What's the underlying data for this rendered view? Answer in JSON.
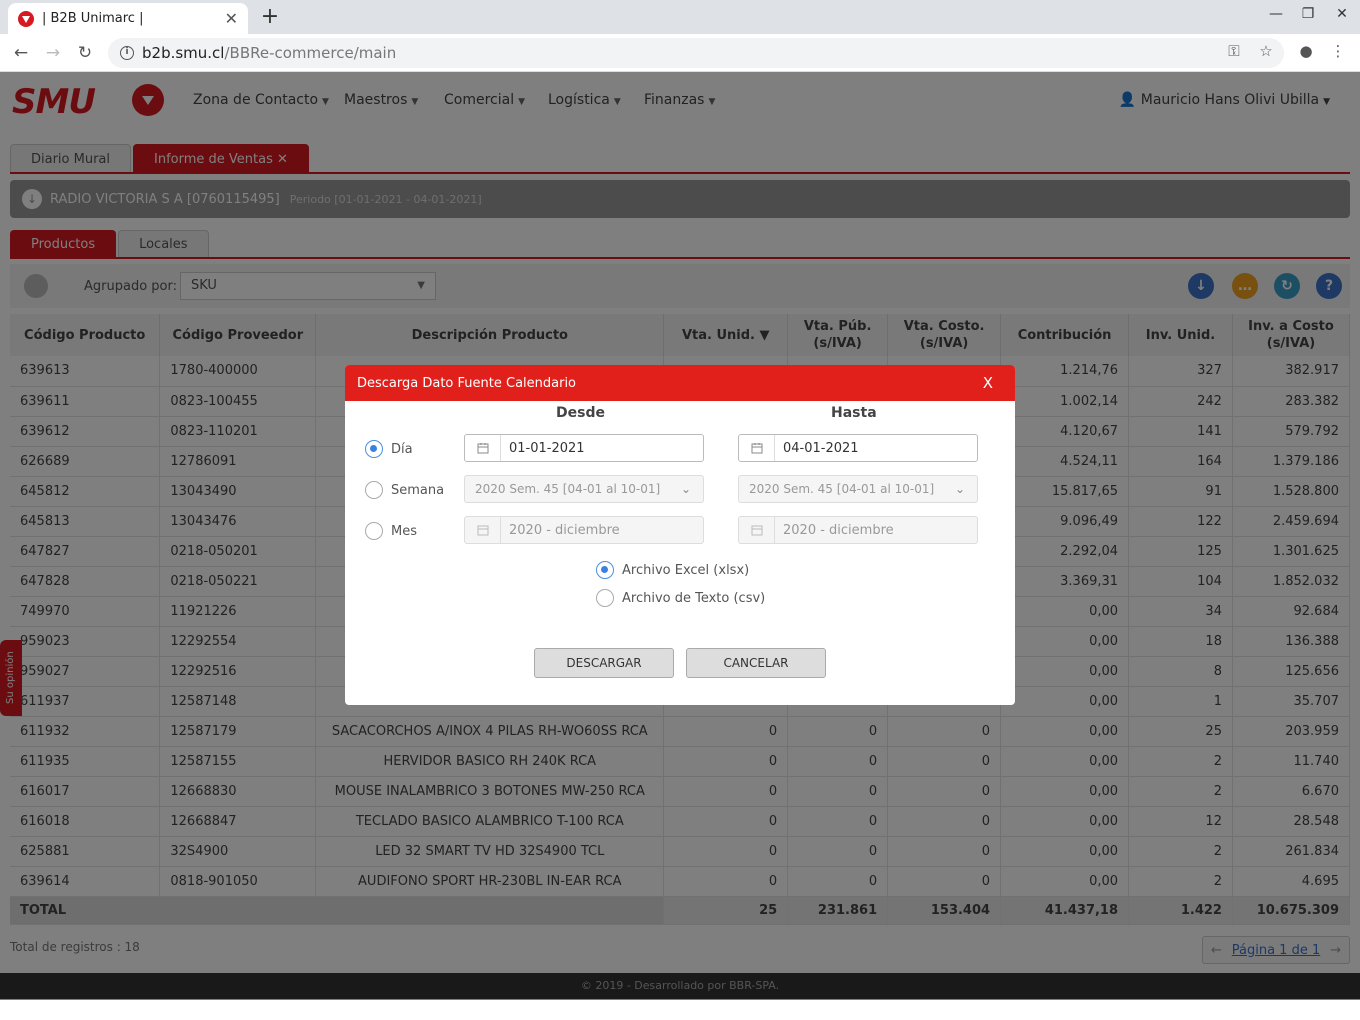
{
  "browser": {
    "tab_title": "| B2B Unimarc |",
    "url_host": "b2b.smu.cl",
    "url_path": "/BBRe-commerce/main"
  },
  "header": {
    "logo_text": "SMU",
    "menus": [
      "Zona de Contacto",
      "Maestros",
      "Comercial",
      "Logística",
      "Finanzas"
    ],
    "user": "Mauricio Hans Olivi Ubilla"
  },
  "tabs": {
    "main": [
      "Diario Mural",
      "Informe de Ventas"
    ],
    "sub": [
      "Productos",
      "Locales"
    ]
  },
  "infobar": {
    "company": "RADIO VICTORIA S A [0760115495]",
    "periodo": "Periodo [01-01-2021 - 04-01-2021]"
  },
  "toolbar": {
    "group_label": "Agrupado por:",
    "group_value": "SKU"
  },
  "table": {
    "headers": [
      "Código Producto",
      "Código Proveedor",
      "Descripción Producto",
      "Vta. Unid.",
      "Vta. Púb. (s/IVA)",
      "Vta. Costo. (s/IVA)",
      "Contribución",
      "Inv. Unid.",
      "Inv. a Costo (s/IVA)"
    ],
    "rows": [
      [
        "639613",
        "1780-400000",
        "",
        "",
        "",
        "",
        "1.214,76",
        "327",
        "382.917"
      ],
      [
        "639611",
        "0823-100455",
        "",
        "",
        "",
        "",
        "1.002,14",
        "242",
        "283.382"
      ],
      [
        "639612",
        "0823-110201",
        "",
        "",
        "",
        "",
        "4.120,67",
        "141",
        "579.792"
      ],
      [
        "626689",
        "12786091",
        "",
        "",
        "",
        "",
        "4.524,11",
        "164",
        "1.379.186"
      ],
      [
        "645812",
        "13043490",
        "",
        "",
        "",
        "",
        "15.817,65",
        "91",
        "1.528.800"
      ],
      [
        "645813",
        "13043476",
        "",
        "",
        "",
        "",
        "9.096,49",
        "122",
        "2.459.694"
      ],
      [
        "647827",
        "0218-050201",
        "",
        "",
        "",
        "",
        "2.292,04",
        "125",
        "1.301.625"
      ],
      [
        "647828",
        "0218-050221",
        "",
        "",
        "",
        "",
        "3.369,31",
        "104",
        "1.852.032"
      ],
      [
        "749970",
        "11921226",
        "",
        "",
        "",
        "",
        "0,00",
        "34",
        "92.684"
      ],
      [
        "959023",
        "12292554",
        "",
        "",
        "",
        "",
        "0,00",
        "18",
        "136.388"
      ],
      [
        "959027",
        "12292516",
        "",
        "",
        "",
        "",
        "0,00",
        "8",
        "125.656"
      ],
      [
        "611937",
        "12587148",
        "",
        "",
        "",
        "",
        "0,00",
        "1",
        "35.707"
      ],
      [
        "611932",
        "12587179",
        "SACACORCHOS A/INOX 4 PILAS RH-WO60SS RCA",
        "0",
        "0",
        "0",
        "0,00",
        "25",
        "203.959"
      ],
      [
        "611935",
        "12587155",
        "HERVIDOR BASICO RH 240K RCA",
        "0",
        "0",
        "0",
        "0,00",
        "2",
        "11.740"
      ],
      [
        "616017",
        "12668830",
        "MOUSE INALAMBRICO 3 BOTONES MW-250 RCA",
        "0",
        "0",
        "0",
        "0,00",
        "2",
        "6.670"
      ],
      [
        "616018",
        "12668847",
        "TECLADO BASICO ALAMBRICO T-100 RCA",
        "0",
        "0",
        "0",
        "0,00",
        "12",
        "28.548"
      ],
      [
        "625881",
        "32S4900",
        "LED 32 SMART TV HD 32S4900 TCL",
        "0",
        "0",
        "0",
        "0,00",
        "2",
        "261.834"
      ],
      [
        "639614",
        "0818-901050",
        "AUDIFONO SPORT HR-230BL IN-EAR RCA",
        "0",
        "0",
        "0",
        "0,00",
        "2",
        "4.695"
      ]
    ],
    "total": [
      "TOTAL",
      "25",
      "231.861",
      "153.404",
      "41.437,18",
      "1.422",
      "10.675.309"
    ]
  },
  "footer_info": {
    "total_registros": "Total de registros : 18",
    "pagina": "Página 1 de 1",
    "copyright": "© 2019 - Desarrollado por BBR-SPA."
  },
  "side_tab": "Su opinión",
  "modal": {
    "title": "Descarga Dato Fuente Calendario",
    "close": "X",
    "desde": "Desde",
    "hasta": "Hasta",
    "dia_label": "Día",
    "semana_label": "Semana",
    "mes_label": "Mes",
    "dia_desde": "01-01-2021",
    "dia_hasta": "04-01-2021",
    "semana_desde": "2020 Sem. 45 [04-01 al 10-01]",
    "semana_hasta": "2020 Sem. 45 [04-01 al 10-01]",
    "mes_desde": "2020 - diciembre",
    "mes_hasta": "2020 - diciembre",
    "fmt_xlsx": "Archivo Excel (xlsx)",
    "fmt_csv": "Archivo de Texto (csv)",
    "btn_download": "DESCARGAR",
    "btn_cancel": "CANCELAR"
  },
  "colors": {
    "brand_red": "#d71920",
    "modal_header": "#e2201b",
    "radio_blue": "#3b82e0"
  },
  "icons": [
    "shield-icon",
    "calendar-icon",
    "chevron-down-icon",
    "search-icon",
    "download-icon",
    "refresh-icon",
    "help-icon",
    "user-icon",
    "key-icon",
    "star-icon"
  ]
}
